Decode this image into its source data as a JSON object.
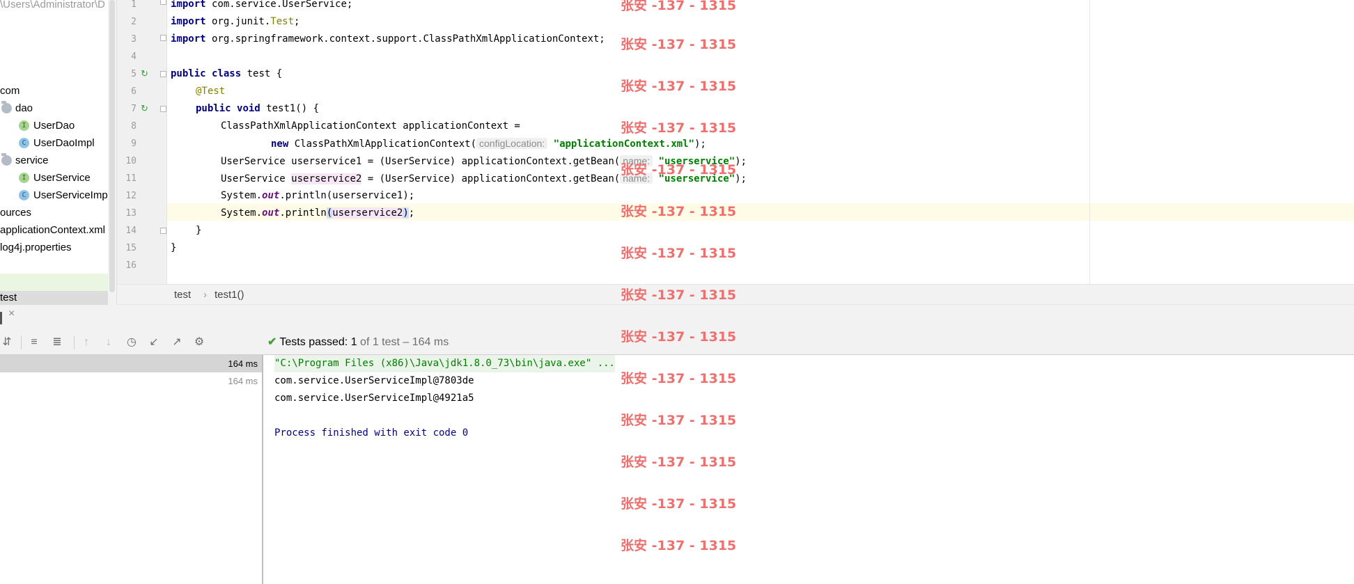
{
  "project_tree": {
    "path_label": "\\Users\\Administrator\\D",
    "items": [
      {
        "label": "com",
        "kind": "package"
      },
      {
        "label": "dao",
        "kind": "folder"
      },
      {
        "label": "UserDao",
        "kind": "interface",
        "icon_letter": "I"
      },
      {
        "label": "UserDaoImpl",
        "kind": "class",
        "icon_letter": "C"
      },
      {
        "label": "service",
        "kind": "folder"
      },
      {
        "label": "UserService",
        "kind": "interface",
        "icon_letter": "I"
      },
      {
        "label": "UserServiceImpl",
        "kind": "class",
        "icon_letter": "C"
      },
      {
        "label": "ources",
        "kind": "folder-partial"
      },
      {
        "label": "applicationContext.xml",
        "kind": "file"
      },
      {
        "label": "log4j.properties",
        "kind": "file"
      },
      {
        "label": "test",
        "kind": "folder-selected"
      }
    ]
  },
  "editor": {
    "line_numbers": [
      "1",
      "2",
      "3",
      "4",
      "5",
      "6",
      "7",
      "8",
      "9",
      "10",
      "11",
      "12",
      "13",
      "14",
      "15",
      "16"
    ],
    "lines": {
      "l1_kw": "import",
      "l1_rest": " com.service.UserService;",
      "l2_kw": "import",
      "l2_a": " org.junit.",
      "l2_ann": "Test",
      "l2_b": ";",
      "l3_kw": "import",
      "l3_rest": " org.springframework.context.support.ClassPathXmlApplicationContext;",
      "l5_kw1": "public",
      "l5_kw2": "class",
      "l5_rest": " test {",
      "l6_ann": "@Test",
      "l7_kw1": "public",
      "l7_kw2": "void",
      "l7_rest": " test1() {",
      "l8": "ClassPathXmlApplicationContext applicationContext =",
      "l9_kw": "new",
      "l9_a": " ClassPathXmlApplicationContext(",
      "l9_hint": "configLocation:",
      "l9_str": "\"applicationContext.xml\"",
      "l9_b": ");",
      "l10_a": "UserService ",
      "l10_var": "userservice1",
      "l10_b": " = (UserService) applicationContext.getBean(",
      "l10_hint": "name:",
      "l10_str": "\"userservice\"",
      "l10_c": ");",
      "l11_a": "UserService ",
      "l11_var": "userservice2",
      "l11_b": " = (UserService) applicationContext.getBean(",
      "l11_hint": "name:",
      "l11_str": "\"userservice\"",
      "l11_c": ");",
      "l12_a": "System.",
      "l12_fld": "out",
      "l12_b": ".println(userservice1);",
      "l13_a": "System.",
      "l13_fld": "out",
      "l13_b": ".println",
      "l13_open": "(",
      "l13_var": "userservice2",
      "l13_close": ")",
      "l13_c": ";",
      "l14": "}",
      "l15": "}"
    }
  },
  "breadcrumb": {
    "class_name": "test",
    "separator": "›",
    "method_name": "test1()"
  },
  "run_panel": {
    "tab_close": "×",
    "status": {
      "label": "Tests passed:",
      "passed": "1",
      "detail": "of 1 test – 164 ms"
    },
    "test_durations": [
      "164 ms",
      "164 ms"
    ],
    "console_lines": [
      "\"C:\\Program Files (x86)\\Java\\jdk1.8.0_73\\bin\\java.exe\" ...",
      "com.service.UserServiceImpl@7803de",
      "com.service.UserServiceImpl@4921a5",
      "Process finished with exit code 0"
    ]
  },
  "watermark": {
    "text": "张安 -137 - 1315"
  },
  "colors": {
    "keyword": "#000080",
    "string": "#008000",
    "annotation": "#808000",
    "field": "#660e7a",
    "console_cmd": "#008000",
    "console_exit": "#000080",
    "watermark": "#ef6f6f",
    "pass_check": "#4a9e3a"
  }
}
